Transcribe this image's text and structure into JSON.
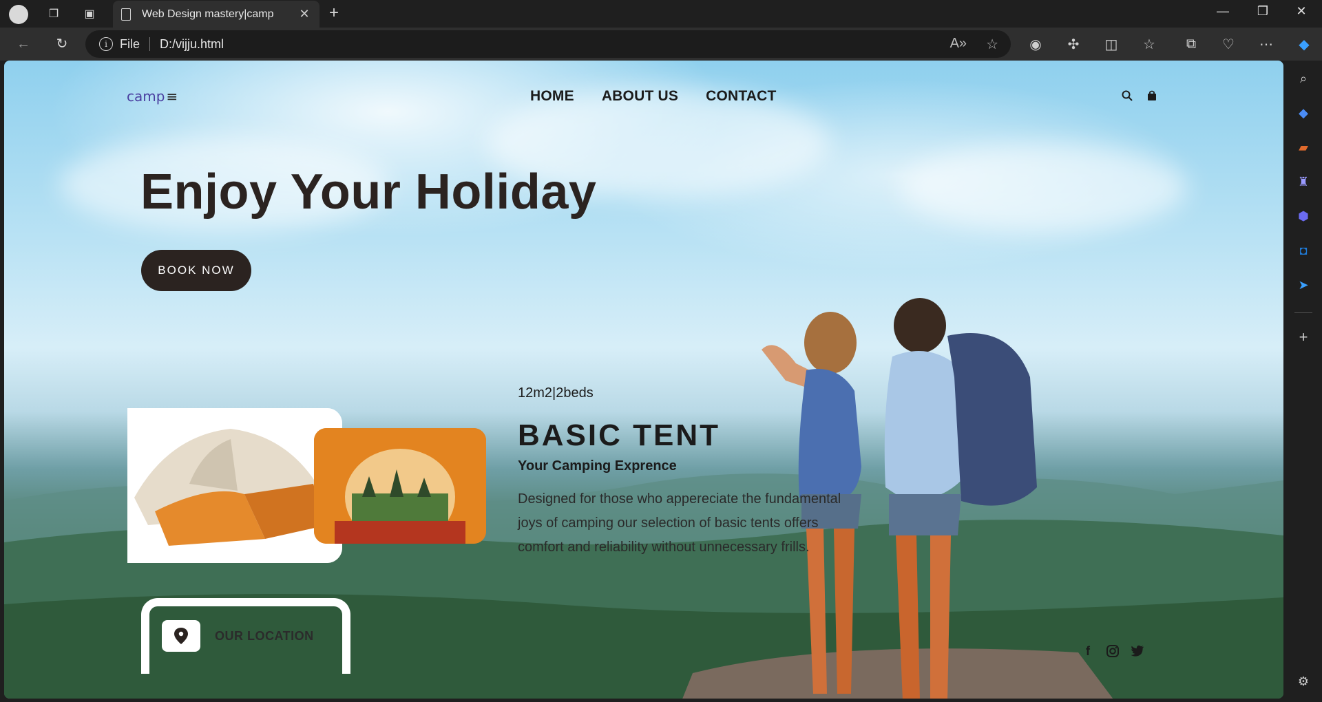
{
  "browser": {
    "tab_title": "Web Design mastery|camp",
    "address_scheme": "File",
    "address_url": "D:/vijju.html"
  },
  "site": {
    "logo_text": "camp",
    "menu_glyph": "≡",
    "nav": [
      "HOME",
      "ABOUT US",
      "CONTACT"
    ]
  },
  "hero": {
    "title": "Enjoy Your Holiday",
    "button_label": "BOOK NOW"
  },
  "product": {
    "spec": "12m2|2beds",
    "title": "BASIC TENT",
    "subtitle": "Your Camping Exprence",
    "description": "Designed for those who appereciate the fundamental joys of camping our selection of basic tents offers comfort and reliability without unnecessary frills."
  },
  "location": {
    "label": "OUR LOCATION"
  },
  "social": [
    "facebook-icon",
    "instagram-icon",
    "twitter-icon"
  ],
  "colors": {
    "dark": "#2b2320",
    "logo": "#4a3fa0",
    "chrome": "#1f1f1f"
  }
}
